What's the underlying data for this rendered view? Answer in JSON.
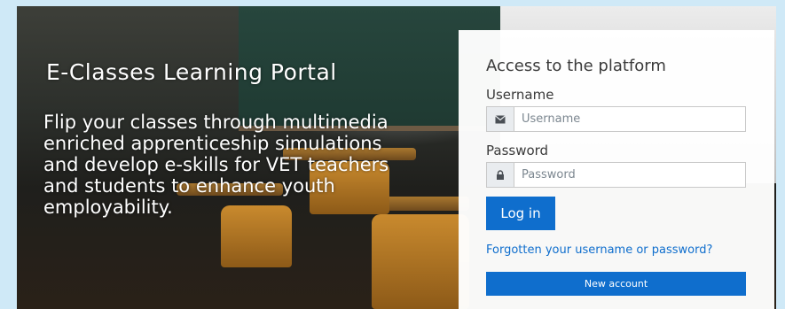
{
  "hero": {
    "title": "E-Classes Learning Portal",
    "description": "Flip your classes through multimedia enriched apprenticeship simulations and develop e-skills for VET teachers and students to enhance youth employability."
  },
  "login": {
    "heading": "Access to the platform",
    "username_label": "Username",
    "username_placeholder": "Username",
    "username_icon": "envelope-icon",
    "password_label": "Password",
    "password_placeholder": "Password",
    "password_icon": "lock-icon",
    "login_button": "Log in",
    "forgot_link": "Forgotten your username or password?",
    "new_account_button": "New account"
  },
  "colors": {
    "primary": "#0f6ecd",
    "page_background": "#cfe9f7",
    "card_background": "#ffffff",
    "text": "#3a3a3a"
  }
}
